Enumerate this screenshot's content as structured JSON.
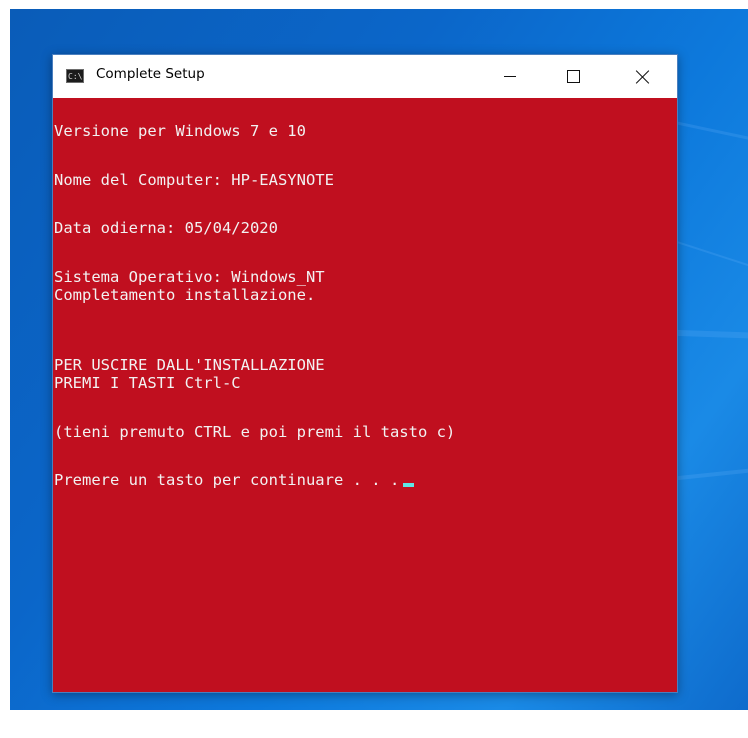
{
  "window": {
    "title": "Complete Setup",
    "icon_label": "C:\\."
  },
  "console": {
    "lines": {
      "l1": "Versione per Windows 7 e 10",
      "l2": "Nome del Computer: HP-EASYNOTE",
      "l3": "Data odierna: 05/04/2020",
      "l4": "Sistema Operativo: Windows_NT",
      "l5": "Completamento installazione.",
      "l6": "PER USCIRE DALL'INSTALLAZIONE",
      "l7": "PREMI I TASTI Ctrl-C",
      "l8": "(tieni premuto CTRL e poi premi il tasto c)",
      "l9": "Premere un tasto per continuare . . ."
    },
    "colors": {
      "background": "#c00f1f",
      "text": "#f2f2f2",
      "cursor": "#5ee6e6"
    }
  },
  "icons": {
    "app": "cmd-icon",
    "minimize": "minimize-icon",
    "maximize": "maximize-icon",
    "close": "close-icon"
  }
}
